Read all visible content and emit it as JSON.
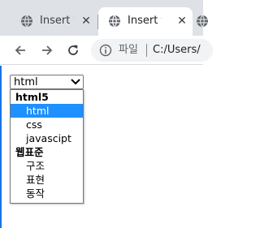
{
  "tabs": [
    {
      "title": "Insert tit",
      "active": false
    },
    {
      "title": "Insert tit",
      "active": true
    }
  ],
  "toolbar": {
    "site_label": "파일",
    "url": "C:/Users/"
  },
  "select": {
    "value": "html"
  },
  "dropdown": {
    "groups": [
      {
        "label": "html5",
        "options": [
          "html",
          "css",
          "javascipt"
        ]
      },
      {
        "label": "웹표준",
        "options": [
          "구조",
          "표현",
          "동작"
        ]
      }
    ],
    "selected_option": "html"
  },
  "colors": {
    "tabstrip": "#dee1e6",
    "selected_option": "#1e90ff",
    "omnibox": "#f1f3f4"
  }
}
